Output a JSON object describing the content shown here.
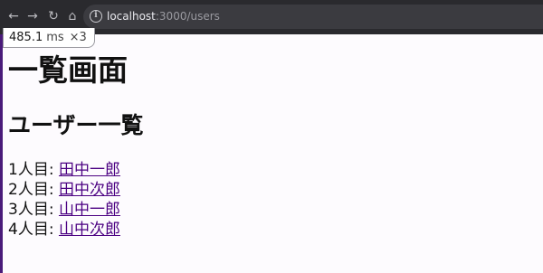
{
  "browser": {
    "url_host": "localhost",
    "url_path": ":3000/users",
    "icons": [
      "back-icon",
      "forward-icon",
      "reload-icon",
      "home-icon",
      "info-icon"
    ]
  },
  "perf_badge": {
    "value": "485.1",
    "unit": "ms",
    "multiplier": "×3"
  },
  "page": {
    "title": "一覧画面",
    "section_title": "ユーザー一覧",
    "users": [
      {
        "prefix": "1人目: ",
        "name": "田中一郎"
      },
      {
        "prefix": "2人目: ",
        "name": "田中次郎"
      },
      {
        "prefix": "3人目: ",
        "name": "山中一郎"
      },
      {
        "prefix": "4人目: ",
        "name": "山中次郎"
      }
    ],
    "link_color": "#4b0082"
  }
}
